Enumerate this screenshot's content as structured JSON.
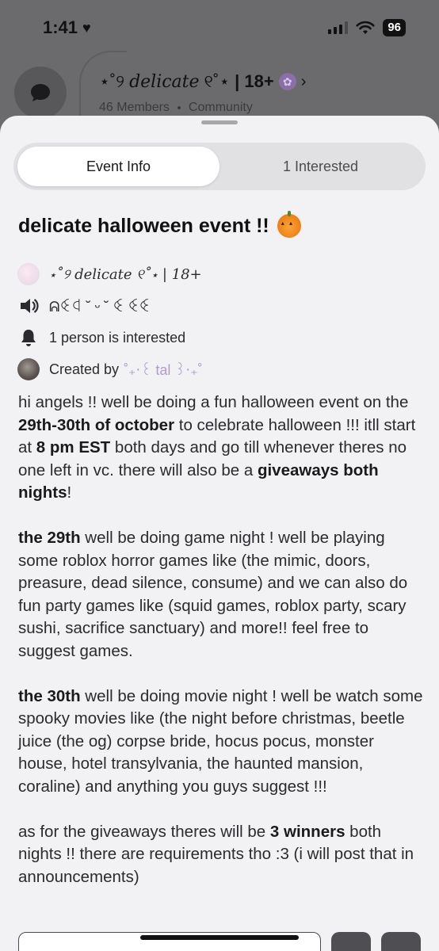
{
  "status_bar": {
    "time": "1:41",
    "battery": "96"
  },
  "server_header": {
    "title_prefix": "⋆˚୨",
    "title_name": "delicate",
    "title_suffix": "୧˚⋆",
    "age": "| 18+",
    "members": "46 Members",
    "type": "Community"
  },
  "tabs": [
    {
      "label": "Event Info",
      "active": true
    },
    {
      "label": "1 Interested",
      "active": false
    }
  ],
  "event": {
    "title": "delicate halloween event !!",
    "server_line": "⋆˚୨ delicate ୧˚⋆ | 18+",
    "channel": "ᕱꒊꒉ ˘ ᵕ ˘ ꒊ ꒊꒊ",
    "interested": "1 person is interested",
    "created_by_label": "Created by",
    "creator": "˚₊‧꒰ tal ꒱‧₊˚"
  },
  "description": {
    "p1_a": "hi angels !! well be doing a fun halloween event on the ",
    "p1_b": "29th-30th of october",
    "p1_c": " to celebrate halloween !!! itll start at ",
    "p1_d": "8 pm EST",
    "p1_e": " both days and go till whenever theres no one left in vc. there will also be a ",
    "p1_f": "giveaways both nights",
    "p1_g": "!",
    "p2_a": "the 29th",
    "p2_b": " well be doing game night ! well be playing some roblox horror games like (the mimic, doors, preasure, dead silence, consume) and we can also do fun party games like (squid games, roblox party, scary sushi, sacrifice sanctuary) and more!! feel free to suggest games.",
    "p3_a": "the 30th",
    "p3_b": " well be doing movie night ! well be watch some spooky movies like (the night before christmas, beetle juice (the og) corpse bride, hocus pocus, monster house, hotel transylvania, the haunted mansion, coraline) and anything you guys suggest !!!",
    "p4_a": "as for the giveaways theres will be ",
    "p4_b": "3 winners",
    "p4_c": " both nights !! there are requirements tho :3 (i will post that in announcements)"
  },
  "colors": {
    "sheet_bg": "#f2f2f4",
    "creator_accent": "#b09bd0",
    "pumpkin": "#ef7d16"
  }
}
